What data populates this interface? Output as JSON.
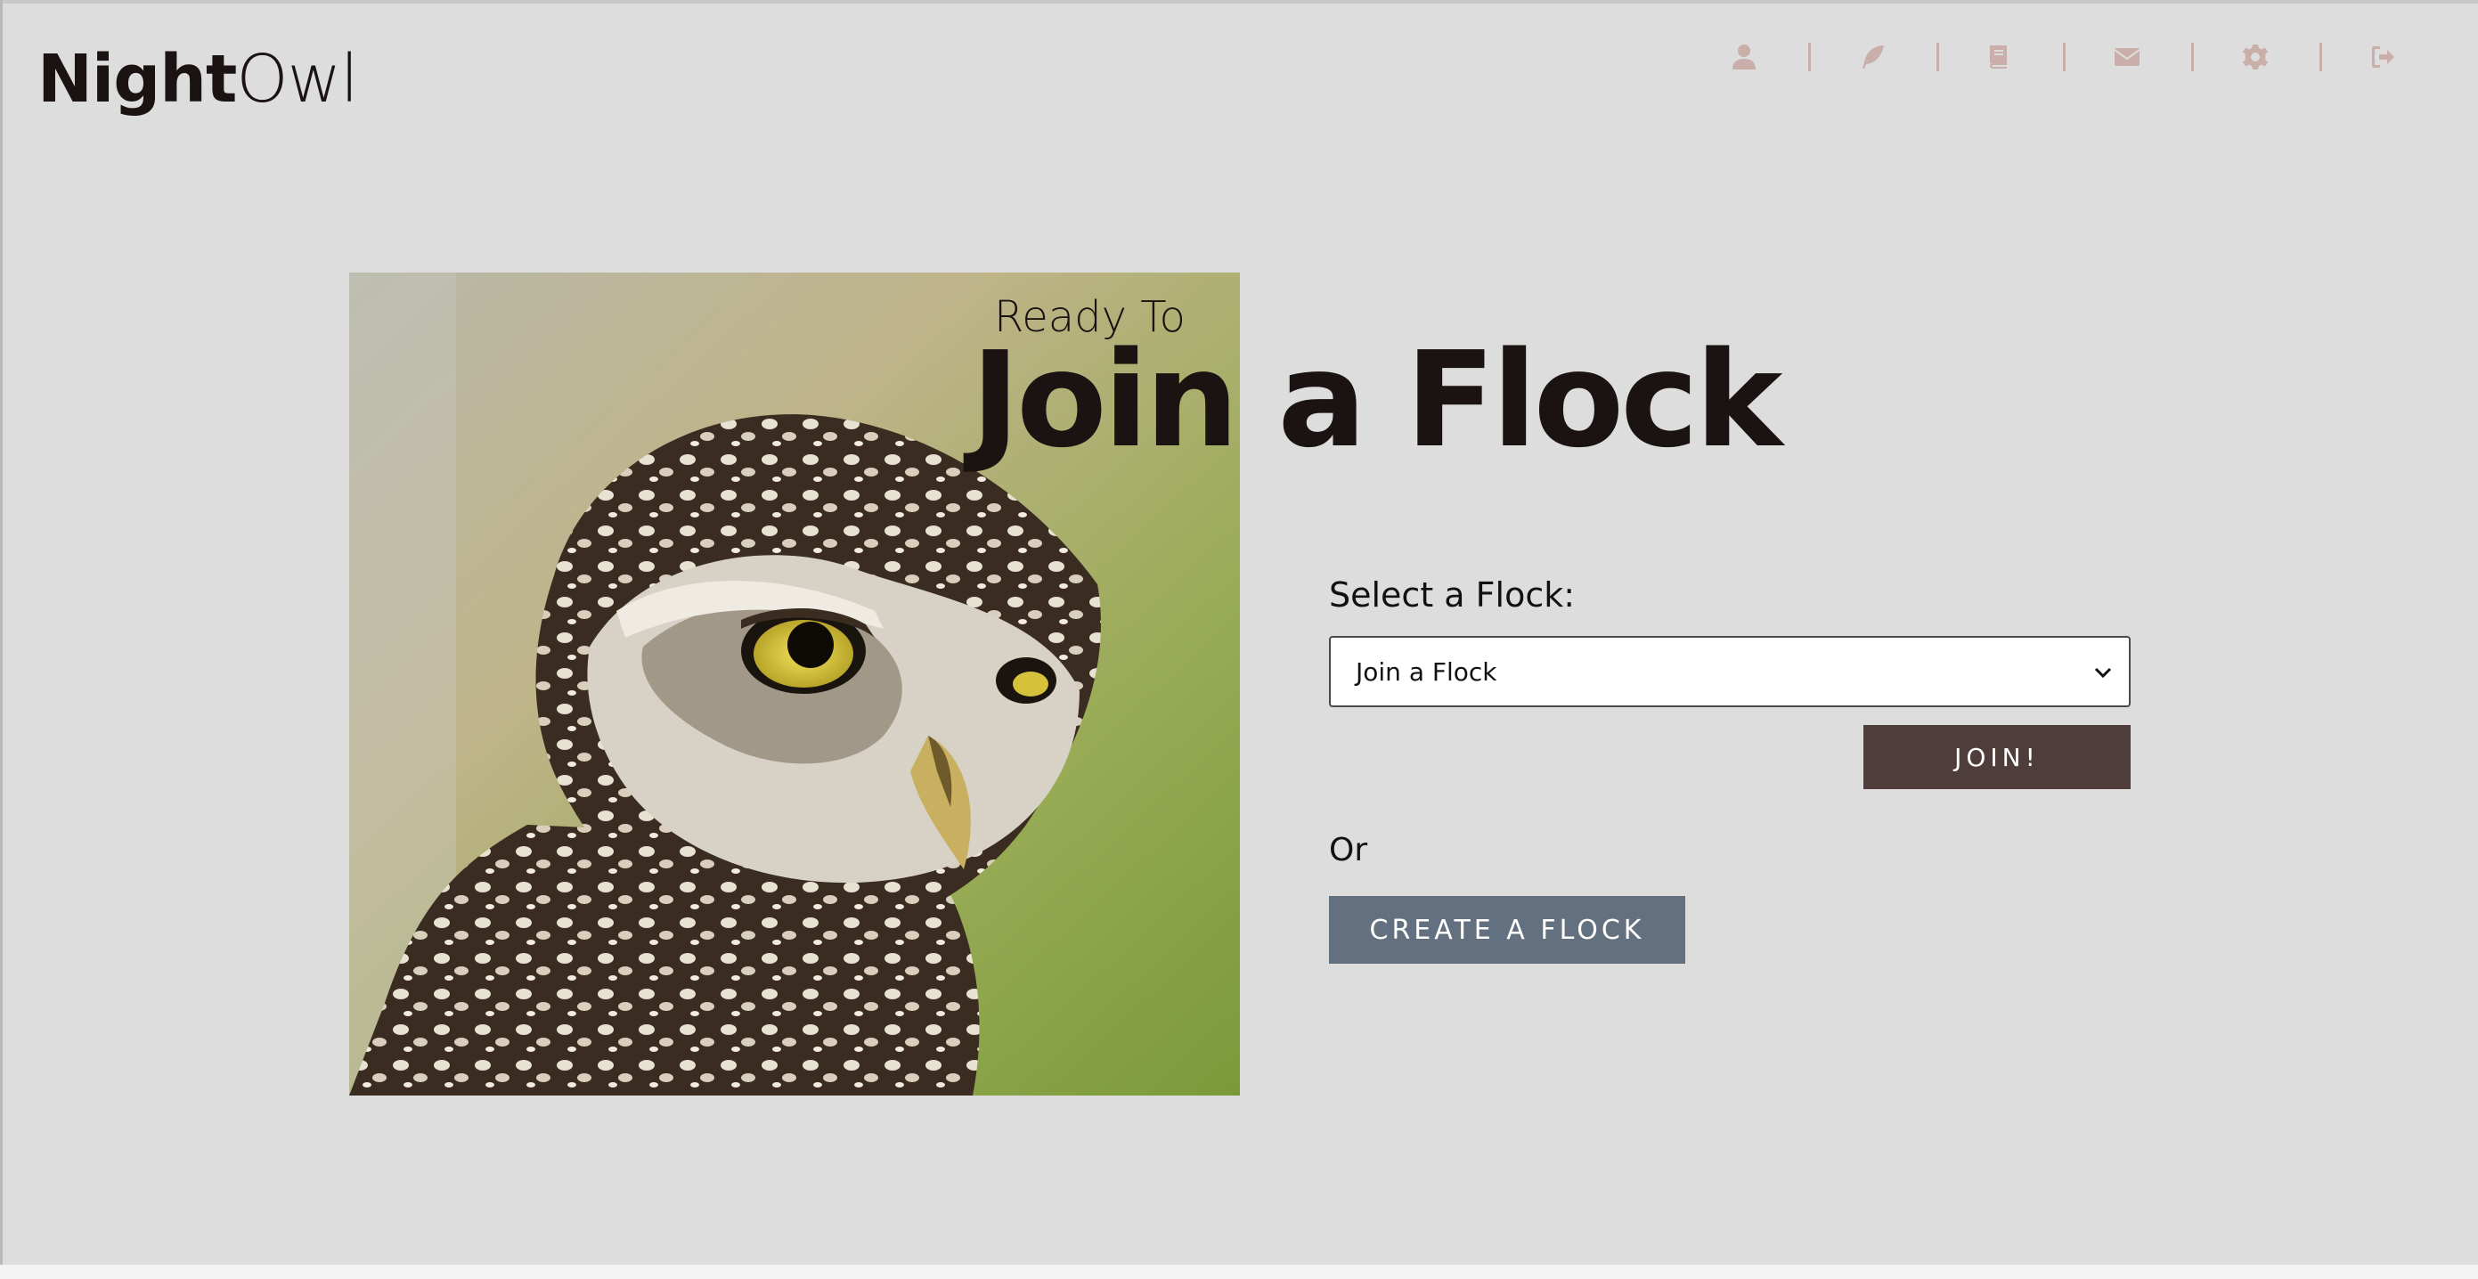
{
  "brand": {
    "bold": "Night",
    "light": "Owl"
  },
  "nav": {
    "items": [
      {
        "icon": "user-icon"
      },
      {
        "icon": "feather-icon"
      },
      {
        "icon": "book-icon"
      },
      {
        "icon": "envelope-icon"
      },
      {
        "icon": "gear-icon"
      },
      {
        "icon": "sign-out-icon"
      }
    ],
    "icon_color": "#c9aeaa"
  },
  "hero": {
    "kicker": "Ready To",
    "headline": "Join a Flock",
    "image": "owl-photo"
  },
  "form": {
    "label": "Select a Flock:",
    "select_value": "Join a Flock",
    "join_label": "JOIN!",
    "or_label": "Or",
    "create_label": "CREATE A FLOCK"
  },
  "colors": {
    "background": "#dddddd",
    "text": "#1b1212",
    "join_button": "#4e3d3b",
    "create_button": "#63707f"
  }
}
